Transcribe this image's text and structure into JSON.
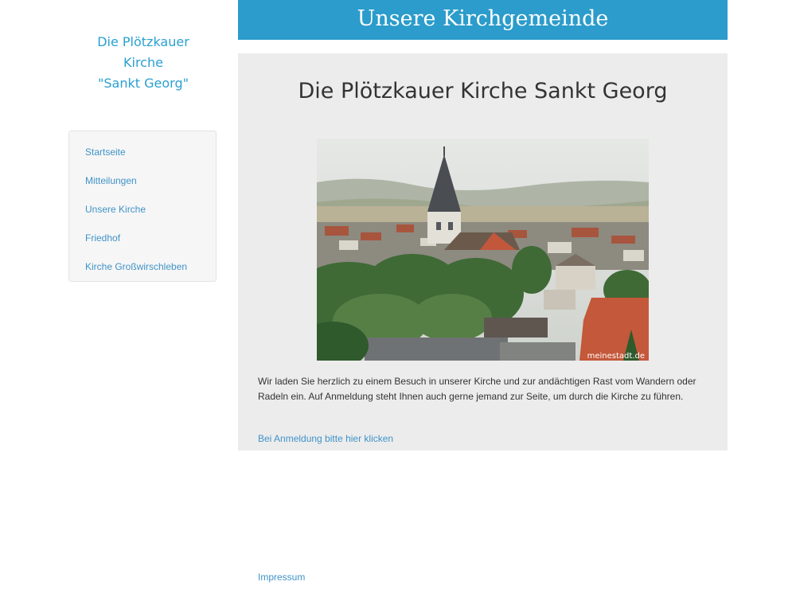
{
  "site": {
    "title_lines": [
      "Die Plötzkauer",
      "Kirche",
      "\"Sankt Georg\""
    ]
  },
  "nav": {
    "items": [
      {
        "label": "Startseite"
      },
      {
        "label": "Mitteilungen"
      },
      {
        "label": "Unsere Kirche"
      },
      {
        "label": "Friedhof"
      },
      {
        "label": "Kirche Großwirschleben"
      }
    ]
  },
  "header": {
    "title": "Unsere Kirchgemeinde"
  },
  "main": {
    "heading": "Die Plötzkauer Kirche Sankt Georg",
    "image": {
      "watermark": "meinestadt.de"
    },
    "paragraph": "Wir laden Sie herzlich  zu einem Besuch in unserer Kirche und zur andächtigen Rast vom Wandern oder Radeln ein. Auf Anmeldung steht Ihnen auch gerne jemand zur Seite, um durch die Kirche zu führen.",
    "signup_link": "Bei Anmeldung bitte hier klicken"
  },
  "footer": {
    "impressum": "Impressum"
  },
  "colors": {
    "accent": "#2b9ccb",
    "link": "#3f93c8",
    "content_bg": "#ececec"
  }
}
